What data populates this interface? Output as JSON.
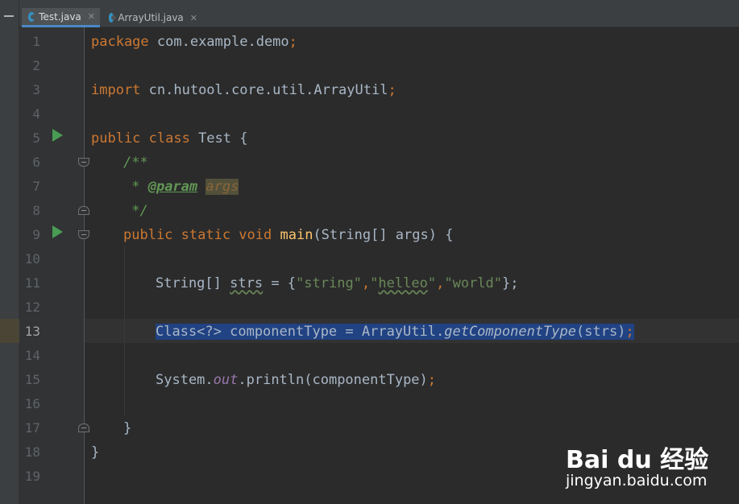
{
  "tabs": [
    {
      "label": "Test.java",
      "active": true
    },
    {
      "label": "ArrayUtil.java",
      "active": false
    }
  ],
  "tab_close_glyph": "✕",
  "code": {
    "l1": {
      "kw": "package",
      "rest": " com.example.demo",
      "semi": ";"
    },
    "l3": {
      "kw": "import",
      "rest": " cn.hutool.core.util.ArrayUtil",
      "semi": ";"
    },
    "l5": {
      "kw": "public class",
      "rest": " Test {"
    },
    "l6": "/**",
    "l7": {
      "star": " * ",
      "tag": "@param",
      "param": "args"
    },
    "l8": " */",
    "l9": {
      "kw": "public static void",
      "fn": "main",
      "rest": "(String[] args) {"
    },
    "l11": {
      "a": "String[] ",
      "b": "strs",
      "c": " = {",
      "s1": "\"string\"",
      "comma1": ",",
      "s2a": "\"",
      "s2b": "helleo",
      "s2c": "\"",
      "comma2": ",",
      "s3": "\"world\"",
      "end": "};"
    },
    "l13": {
      "a": "Class<?> componentType = ArrayUtil.",
      "b": "getComponentType",
      "c": "(strs)",
      "d": ";"
    },
    "l15": {
      "a": "System.",
      "b": "out",
      "c": ".println(componentType)",
      "d": ";"
    },
    "l17": "}",
    "l18": "}"
  },
  "line_numbers": [
    "1",
    "2",
    "3",
    "4",
    "5",
    "6",
    "7",
    "8",
    "9",
    "10",
    "11",
    "12",
    "13",
    "14",
    "15",
    "16",
    "17",
    "18",
    "19"
  ],
  "current_line": "13",
  "watermark": {
    "logo": "Bai du 经验",
    "url": "jingyan.baidu.com"
  },
  "colors": {
    "keyword": "#cc7832",
    "string": "#6a8759",
    "selection": "#214283",
    "gutter_run": "#499c54"
  }
}
